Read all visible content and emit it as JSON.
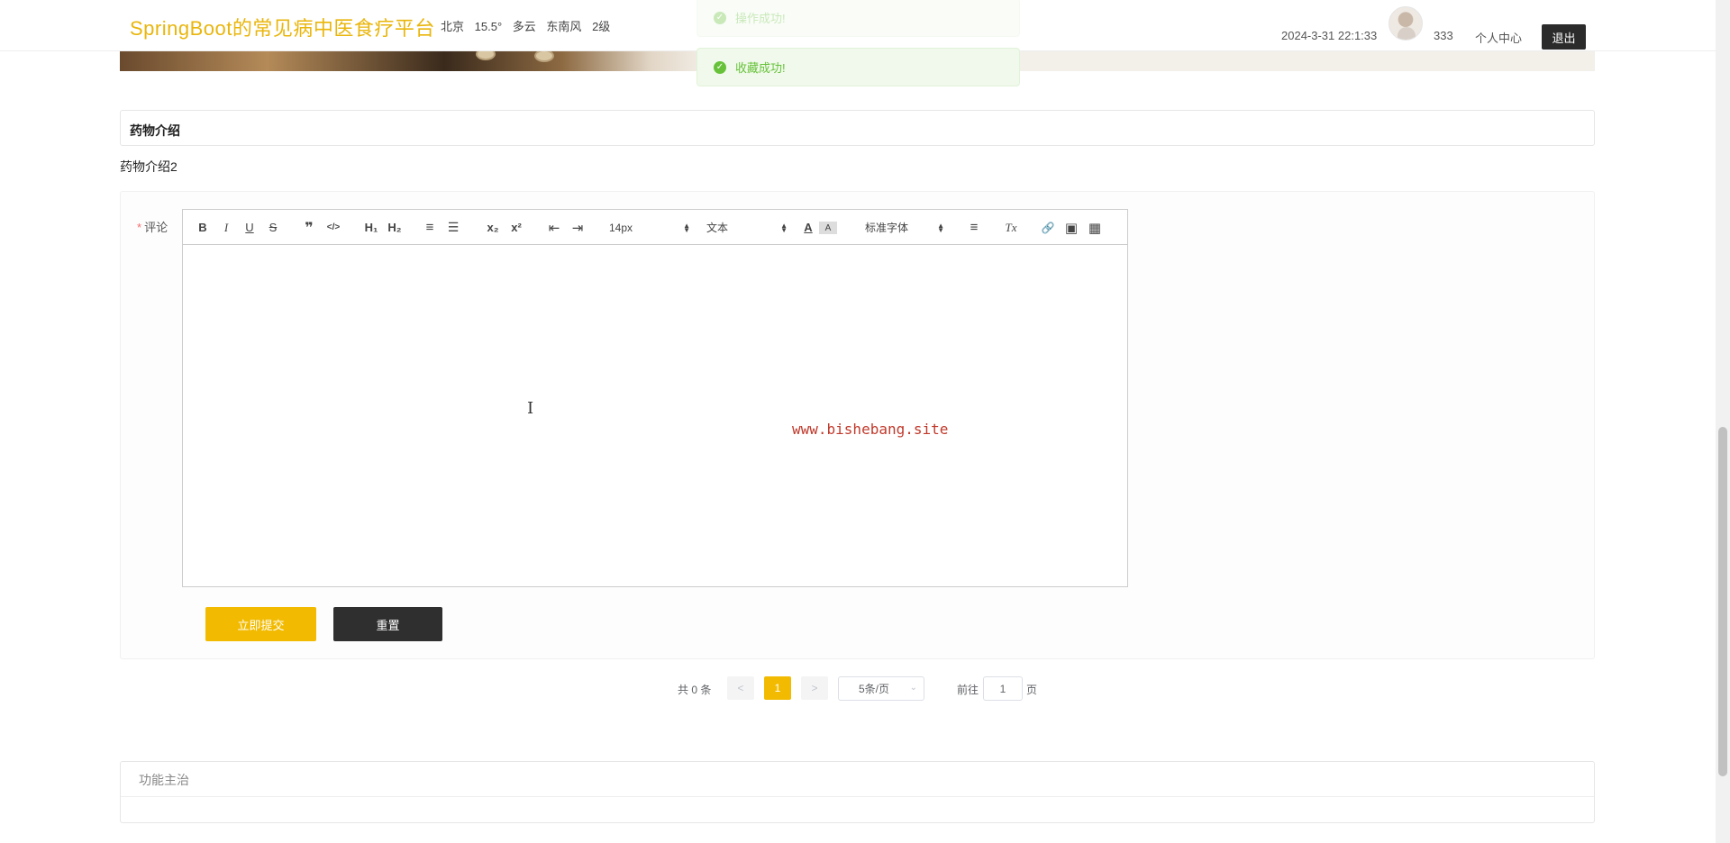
{
  "header": {
    "site_title": "SpringBoot的常见病中医食疗平台",
    "weather": {
      "city": "北京",
      "temperature": "15.5°",
      "condition": "多云",
      "wind_direction": "东南风",
      "wind_level": "2级"
    },
    "datetime": "2024-3-31 22:1:33",
    "username": "333",
    "user_center_label": "个人中心",
    "logout_label": "退出"
  },
  "toasts": {
    "faded_message": "操作成功!",
    "main_message": "收藏成功!",
    "icon": "check-circle-icon",
    "color": "#67c23a"
  },
  "section": {
    "title": "药物介绍",
    "content": "药物介绍2"
  },
  "comment_form": {
    "label": "评论",
    "required_mark": "*",
    "toolbar": {
      "bold": "B",
      "italic": "I",
      "underline": "U",
      "strike": "S",
      "blockquote": "❞",
      "code": "</>",
      "h1": "H₁",
      "h2": "H₂",
      "ordered_list": "≡",
      "bullet_list": "☰",
      "subscript": "x₂",
      "superscript": "x²",
      "outdent": "⇤",
      "indent": "⇥",
      "size_value": "14px",
      "header_value": "文本",
      "font_value": "标准字体",
      "font_color": "A",
      "background": "A",
      "align": "≡",
      "clean": "Tx",
      "link": "🔗",
      "image": "▣",
      "video": "▦"
    },
    "cursor_glyph": "I",
    "watermark": "www.bishebang.site",
    "submit_label": "立即提交",
    "reset_label": "重置"
  },
  "pagination": {
    "total_text": "共 0 条",
    "prev": "<",
    "current_page": "1",
    "next": ">",
    "page_size": "5条/页",
    "goto_label": "前往",
    "goto_value": "1",
    "page_suffix": "页"
  },
  "function_box": {
    "title": "功能主治"
  },
  "colors": {
    "brand_yellow": "#f2bb02",
    "title_yellow": "#e9b60c",
    "dark_button": "#2f2f2f",
    "success_green": "#67c23a"
  }
}
